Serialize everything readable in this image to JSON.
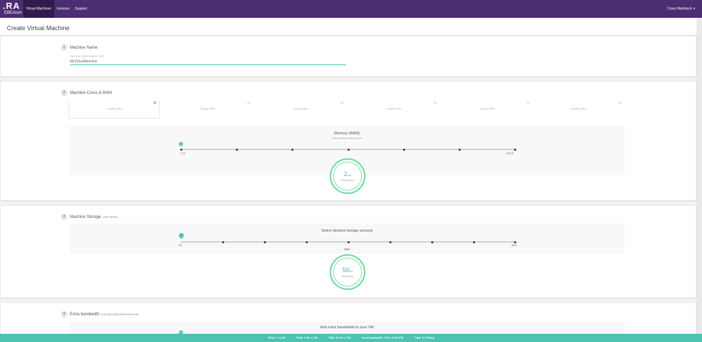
{
  "nav": {
    "logo_main": ".RA",
    "logo_sub": "EBEAcon",
    "items": [
      "Virtual Machines",
      "Invoices",
      "Support"
    ],
    "user_name": "Corey Marsheck"
  },
  "page": {
    "title": "Create Virtual Machine"
  },
  "machine_name": {
    "step": "1",
    "title": "Machine Name",
    "input_label": "Type your Virtual Machine name",
    "input_value": "MyVirtualMachine"
  },
  "cores_ram": {
    "step": "2",
    "title": "Machine Cores & RAM",
    "cpu_options": [
      "1 Core CPU",
      "2 Core CPU",
      "3 Core CPU",
      "4 Core CPU",
      "5 Core CPU",
      "6 Core CPU"
    ],
    "selected_cpu": 0,
    "memory_title": "Memory (RAM)",
    "memory_sub": "Select desired RAM amount",
    "memory_thumb": "2",
    "memory_min_label": "2 Gb",
    "memory_max_label": "128 Gb",
    "memory_value": "2",
    "memory_unit": "GB",
    "memory_caption": "Virtual Memory"
  },
  "storage": {
    "step": "3",
    "title": "Machine Storage",
    "subtitle": "(SSD DRIVE)",
    "box_title": "Select desired storage amount",
    "min_label": "50",
    "mid_label": "1000",
    "max_label": "5000",
    "value": "50",
    "unit": "Gb",
    "caption": "SSD Storage"
  },
  "bandwidth": {
    "step": "4",
    "title": "Extra bandwidth",
    "subtitle": "(2TB INCLUDED WITH EACH VM)",
    "box_title": "Add extra bandwidth to your VM",
    "thumb": "0"
  },
  "summary": {
    "items": [
      "CPUs: 1 x 4.00",
      "RAM: 2 Gb x 1.00",
      "SSD: 50 Gb x 0.05",
      "Extra bandwidth: 0 TB x 5.00 $/TB",
      "Total: $ 7.50/day"
    ]
  },
  "colors": {
    "nav_bg": "#4b2d73",
    "accent": "#4cc2b3",
    "circle": "#67d99a"
  }
}
